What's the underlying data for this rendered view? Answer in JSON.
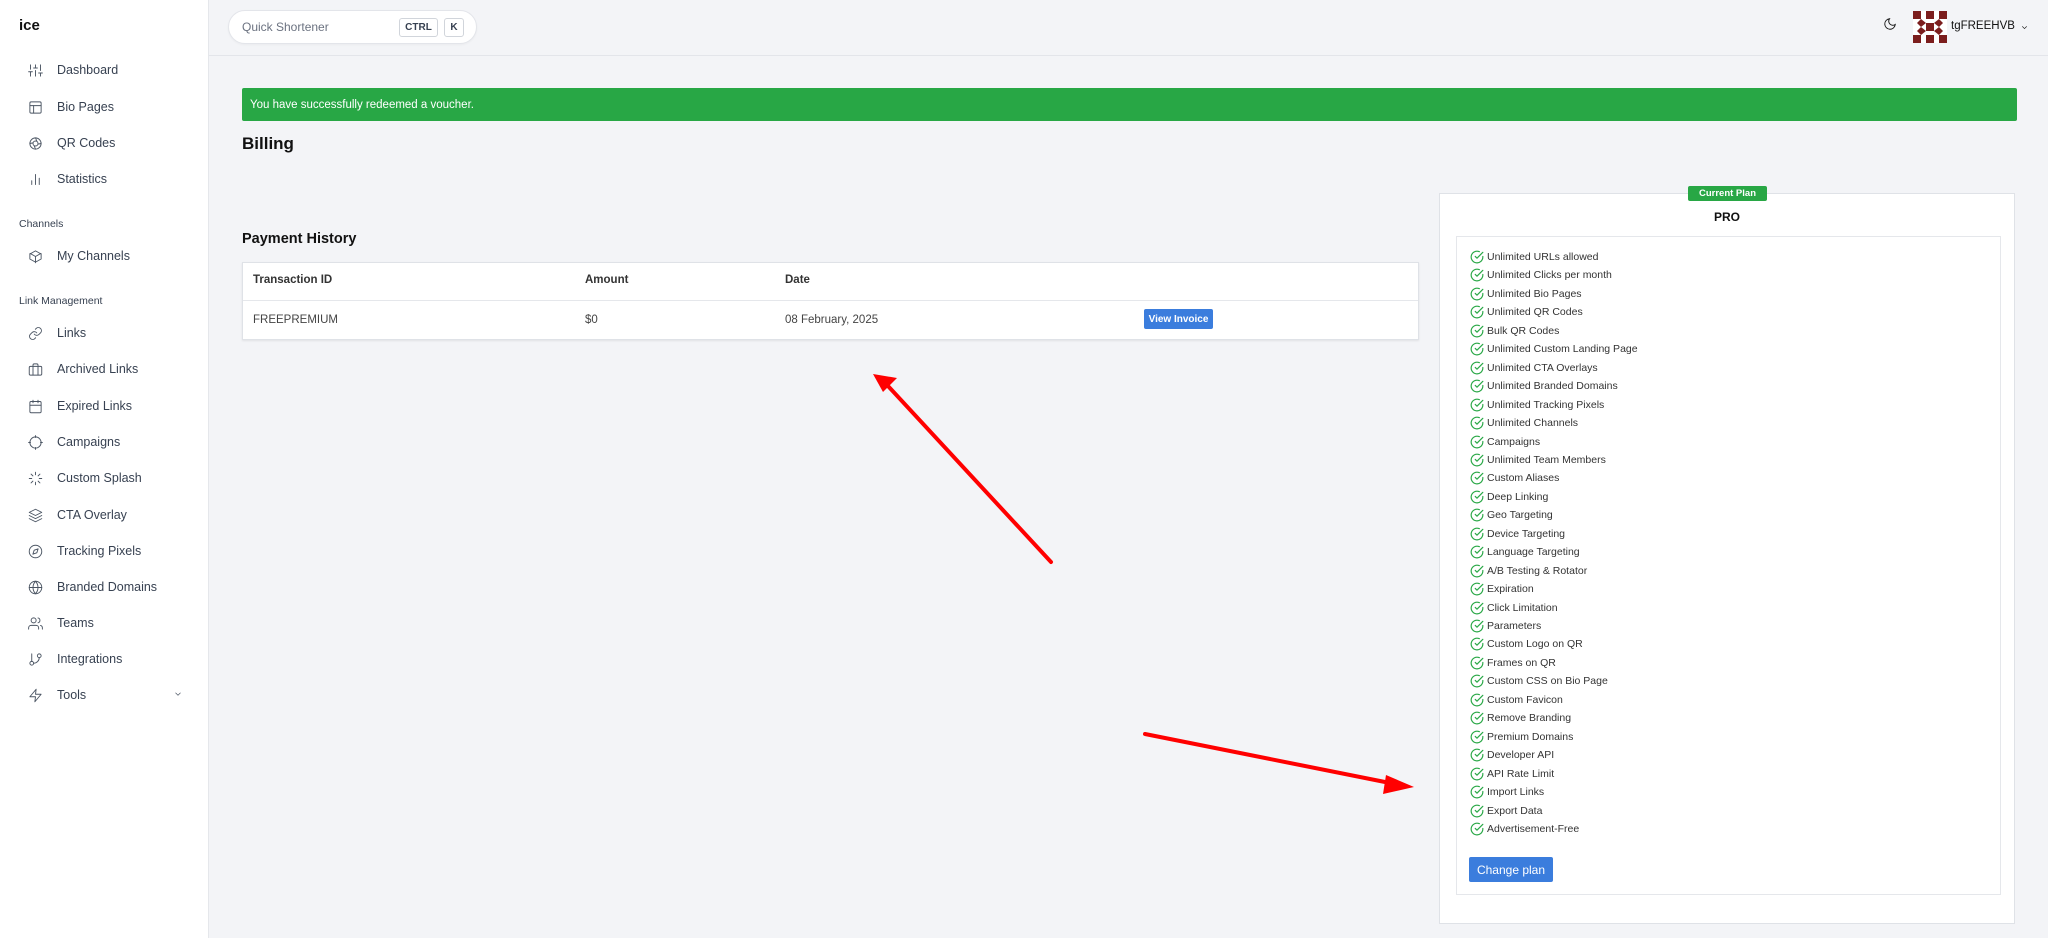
{
  "app": {
    "logo": "ice"
  },
  "sidebar": {
    "main_items": [
      {
        "label": "Dashboard",
        "icon": "sliders-icon"
      },
      {
        "label": "Bio Pages",
        "icon": "layout-icon"
      },
      {
        "label": "QR Codes",
        "icon": "qr-icon"
      },
      {
        "label": "Statistics",
        "icon": "bar-chart-icon"
      }
    ],
    "channels_heading": "Channels",
    "channel_items": [
      {
        "label": "My Channels",
        "icon": "box-icon"
      }
    ],
    "link_heading": "Link Management",
    "link_items": [
      {
        "label": "Links",
        "icon": "link-icon"
      },
      {
        "label": "Archived Links",
        "icon": "briefcase-icon"
      },
      {
        "label": "Expired Links",
        "icon": "calendar-icon"
      },
      {
        "label": "Campaigns",
        "icon": "target-icon"
      },
      {
        "label": "Custom Splash",
        "icon": "loader-icon"
      },
      {
        "label": "CTA Overlay",
        "icon": "layers-icon"
      },
      {
        "label": "Tracking Pixels",
        "icon": "compass-icon"
      },
      {
        "label": "Branded Domains",
        "icon": "globe-icon"
      },
      {
        "label": "Teams",
        "icon": "users-icon"
      },
      {
        "label": "Integrations",
        "icon": "git-branch-icon"
      },
      {
        "label": "Tools",
        "icon": "zap-icon"
      }
    ]
  },
  "topbar": {
    "search_placeholder": "Quick Shortener",
    "shortcut_key1": "CTRL",
    "shortcut_key2": "K",
    "username": "tgFREEHVB"
  },
  "alert": {
    "message": "You have successfully redeemed a voucher."
  },
  "page": {
    "title": "Billing"
  },
  "payment_history": {
    "title": "Payment History",
    "columns": [
      "Transaction ID",
      "Amount",
      "Date"
    ],
    "rows": [
      {
        "transaction_id": "FREEPREMIUM",
        "amount": "$0",
        "date": "08 February, 2025",
        "action": "View Invoice"
      }
    ]
  },
  "plan": {
    "badge": "Current Plan",
    "name": "PRO",
    "features": [
      "Unlimited URLs allowed",
      "Unlimited Clicks per month",
      "Unlimited Bio Pages",
      "Unlimited QR Codes",
      "Bulk QR Codes",
      "Unlimited Custom Landing Page",
      "Unlimited CTA Overlays",
      "Unlimited Branded Domains",
      "Unlimited Tracking Pixels",
      "Unlimited Channels",
      "Campaigns",
      "Unlimited Team Members",
      "Custom Aliases",
      "Deep Linking",
      "Geo Targeting",
      "Device Targeting",
      "Language Targeting",
      "A/B Testing & Rotator",
      "Expiration",
      "Click Limitation",
      "Parameters",
      "Custom Logo on QR",
      "Frames on QR",
      "Custom CSS on Bio Page",
      "Custom Favicon",
      "Remove Branding",
      "Premium Domains",
      "Developer API",
      "API Rate Limit",
      "Import Links",
      "Export Data",
      "Advertisement-Free"
    ],
    "change_label": "Change plan"
  },
  "colors": {
    "success": "#28a745",
    "primary": "#3b7ddd",
    "annotation_arrow": "#ff0000",
    "check": "#28a745"
  }
}
